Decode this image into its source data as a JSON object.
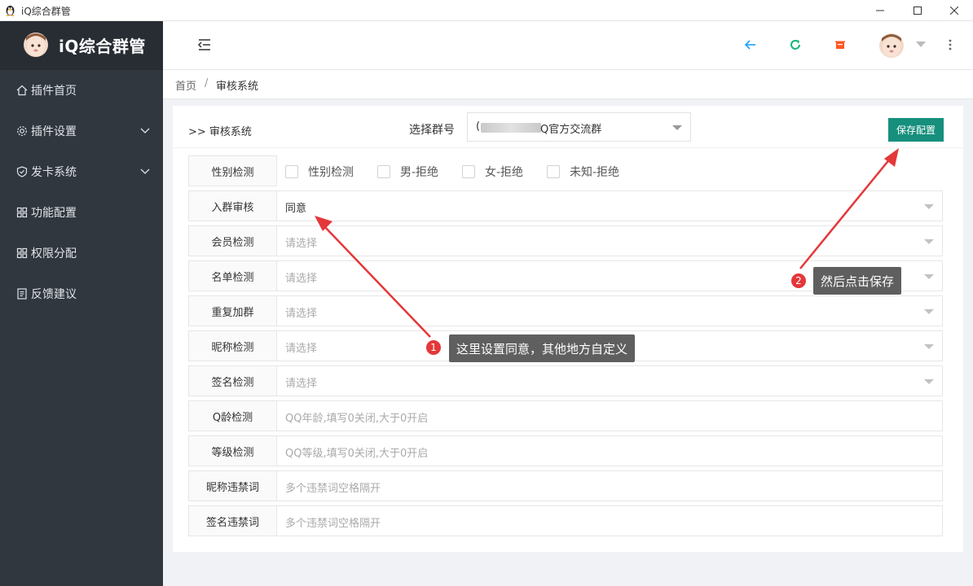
{
  "window": {
    "title": "iQ综合群管"
  },
  "sidebar": {
    "brand": "iQ综合群管",
    "items": [
      {
        "label": "插件首页",
        "icon": "home-icon",
        "has_arrow": false
      },
      {
        "label": "插件设置",
        "icon": "gear-icon",
        "has_arrow": true
      },
      {
        "label": "发卡系统",
        "icon": "shield-icon",
        "has_arrow": true
      },
      {
        "label": "功能配置",
        "icon": "grid-icon",
        "has_arrow": false
      },
      {
        "label": "权限分配",
        "icon": "grid-icon",
        "has_arrow": false
      },
      {
        "label": "反馈建议",
        "icon": "feedback-icon",
        "has_arrow": false
      }
    ]
  },
  "header": {
    "icons": [
      "menu-collapse-icon",
      "back-arrow-icon",
      "refresh-icon",
      "clear-cache-icon",
      "user-avatar",
      "chevron-down-icon",
      "more-vertical-icon"
    ],
    "colors": {
      "back": "#1e9fff",
      "refresh": "#16b777",
      "clear": "#ff5722"
    }
  },
  "breadcrumb": {
    "home": "首页",
    "sep": "/",
    "current": "审核系统"
  },
  "card": {
    "title": ">> 审核系统",
    "group_label": "选择群号",
    "group_value_prefix": "(",
    "group_value": "Q官方交流群",
    "save_label": "保存配置"
  },
  "form": {
    "gender": {
      "label": "性别检测",
      "options": [
        "性别检测",
        "男-拒绝",
        "女-拒绝",
        "未知-拒绝"
      ]
    },
    "rows": [
      {
        "label": "入群审核",
        "value": "同意",
        "type": "select"
      },
      {
        "label": "会员检测",
        "placeholder": "请选择",
        "type": "select"
      },
      {
        "label": "名单检测",
        "placeholder": "请选择",
        "type": "select"
      },
      {
        "label": "重复加群",
        "placeholder": "请选择",
        "type": "select"
      },
      {
        "label": "昵称检测",
        "placeholder": "请选择",
        "type": "select"
      },
      {
        "label": "签名检测",
        "placeholder": "请选择",
        "type": "select"
      },
      {
        "label": "Q龄检测",
        "placeholder": "QQ年龄,填写0关闭,大于0开启",
        "type": "input"
      },
      {
        "label": "等级检测",
        "placeholder": "QQ等级,填写0关闭,大于0开启",
        "type": "input"
      },
      {
        "label": "昵称违禁词",
        "placeholder": "多个违禁词空格隔开",
        "type": "input"
      },
      {
        "label": "签名违禁词",
        "placeholder": "多个违禁词空格隔开",
        "type": "input"
      }
    ]
  },
  "annotations": [
    {
      "number": "1",
      "text": "这里设置同意，其他地方自定义"
    },
    {
      "number": "2",
      "text": "然后点击保存"
    }
  ],
  "colors": {
    "accent": "#168f7d",
    "sidebar": "#30373f",
    "annotation_red": "#e4373a"
  }
}
